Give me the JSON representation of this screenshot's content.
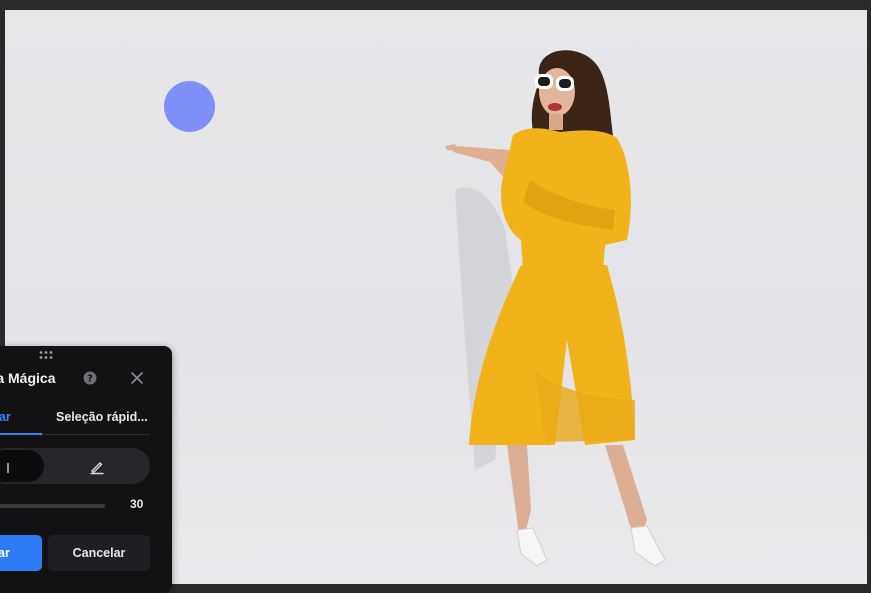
{
  "panel": {
    "title": "cha Mágica",
    "tabs": [
      {
        "label": "var",
        "active": true
      },
      {
        "label": "Seleção rápid...",
        "active": false
      }
    ],
    "brush_size": "30",
    "apply_label": "ar",
    "cancel_label": "Cancelar"
  },
  "colors": {
    "accent": "#2e7cf6",
    "brush_cursor": "#7f8ff7",
    "panel_bg": "#121214",
    "outfit_yellow": "#f0b41a"
  },
  "icons": [
    "drag-handle-icon",
    "help-icon",
    "close-icon",
    "brush-icon"
  ]
}
